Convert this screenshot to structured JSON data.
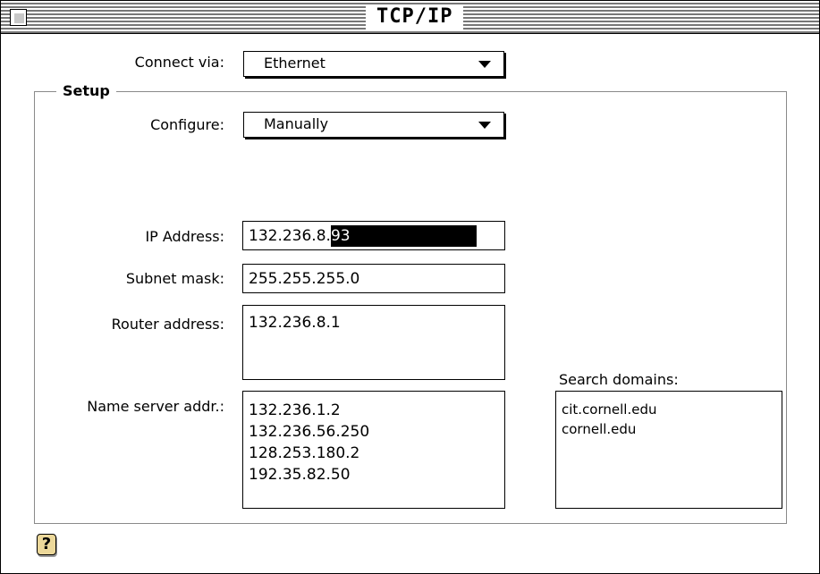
{
  "window": {
    "title": "TCP/IP"
  },
  "connect": {
    "label": "Connect via:",
    "value": "Ethernet"
  },
  "setup": {
    "title": "Setup",
    "configure": {
      "label": "Configure:",
      "value": "Manually"
    },
    "ip": {
      "label": "IP Address:",
      "prefix": "132.236.8.",
      "selected": "93"
    },
    "subnet": {
      "label": "Subnet mask:",
      "value": "255.255.255.0"
    },
    "router": {
      "label": "Router address:",
      "lines": [
        "132.236.8.1"
      ]
    },
    "nameserver": {
      "label": "Name server addr.:",
      "lines": [
        "132.236.1.2",
        "132.236.56.250",
        "128.253.180.2",
        "192.35.82.50"
      ]
    },
    "search": {
      "label": "Search domains:",
      "lines": [
        "cit.cornell.edu",
        "cornell.edu"
      ]
    }
  },
  "help": {
    "icon": "help-icon",
    "glyph": "?"
  }
}
